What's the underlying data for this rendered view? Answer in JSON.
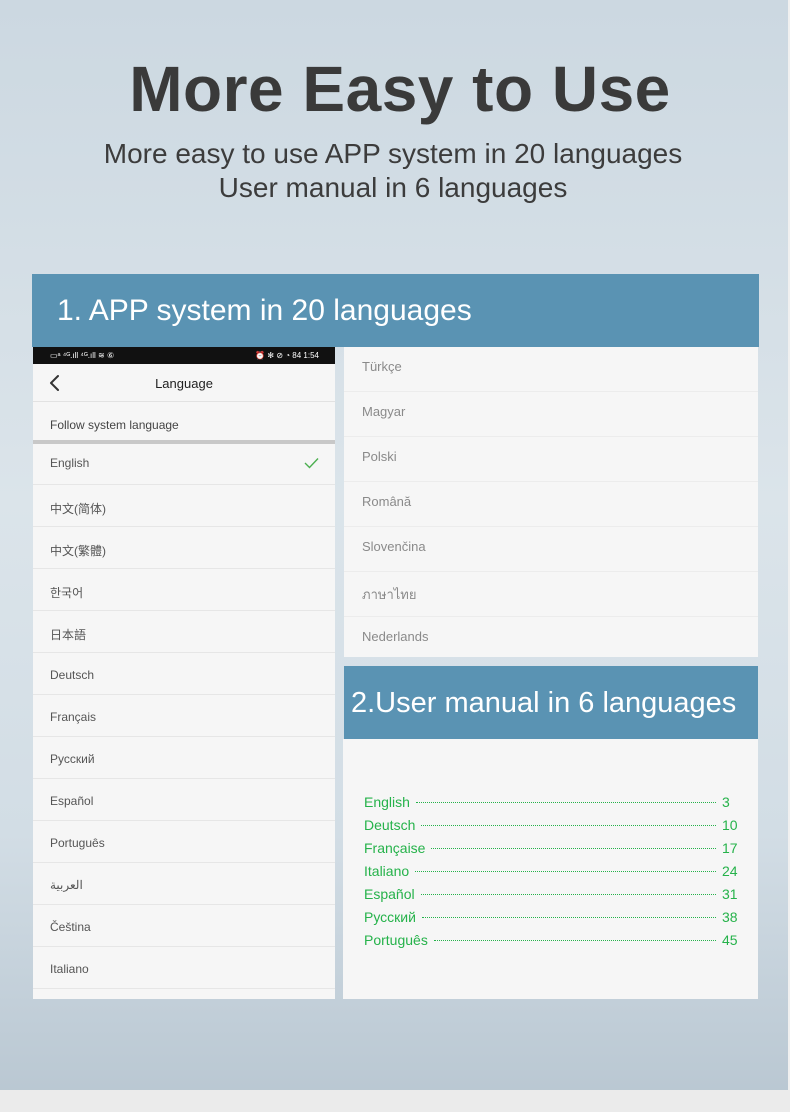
{
  "hero": {
    "title": "More Easy to Use",
    "subtitle_line1": "More easy to use APP system in 20 languages",
    "subtitle_line2": "User manual in 6 languages"
  },
  "section1": {
    "title": "1. APP system in 20 languages"
  },
  "phone": {
    "status_left": "▭ᵃ ⁴ᴳ.ıll ⁴ᴳ.ıll ≋ ⑥",
    "status_right": "⏰ ✻ ⊘ ◔ 84 1:54",
    "header_title": "Language",
    "follow_system": "Follow system language",
    "languages": [
      {
        "label": "English",
        "selected": true
      },
      {
        "label": "中文(简体)"
      },
      {
        "label": "中文(繁體)"
      },
      {
        "label": "한국어"
      },
      {
        "label": "日本語"
      },
      {
        "label": "Deutsch"
      },
      {
        "label": "Français"
      },
      {
        "label": "Русский"
      },
      {
        "label": "Español"
      },
      {
        "label": "Português"
      },
      {
        "label": "العربية"
      },
      {
        "label": "Čeština"
      },
      {
        "label": "Italiano"
      }
    ]
  },
  "more_languages": [
    "Türkçe",
    "Magyar",
    "Polski",
    "Română",
    "Slovenčina",
    "ภาษาไทย",
    "Nederlands"
  ],
  "section2": {
    "title": "2.User manual in 6 languages"
  },
  "manual_toc": [
    {
      "label": "English",
      "page": "3"
    },
    {
      "label": "Deutsch",
      "page": "10"
    },
    {
      "label": "Française",
      "page": "17"
    },
    {
      "label": "Italiano",
      "page": "24"
    },
    {
      "label": "Español",
      "page": "31"
    },
    {
      "label": "Русский",
      "page": "38"
    },
    {
      "label": "Português",
      "page": "45"
    }
  ],
  "colors": {
    "banner": "#5a93b3",
    "toc_green": "#25b24a",
    "check_green": "#4caf50"
  },
  "icons": {
    "back": "chevron-left-icon",
    "check": "checkmark-icon"
  }
}
